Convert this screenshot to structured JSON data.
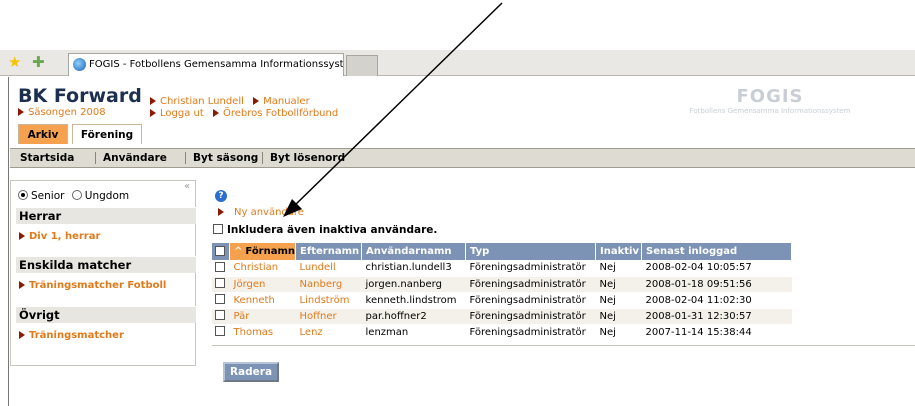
{
  "browser": {
    "tab_title": "FOGIS - Fotbollens Gemensamma Informationssystem"
  },
  "header": {
    "org_name": "BK Forward",
    "season": "Säsongen 2008",
    "links_row1": [
      "Christian Lundell",
      "Manualer"
    ],
    "links_row2": [
      "Logga ut",
      "Örebros Fotbollförbund"
    ],
    "brand_title": "FOGIS",
    "brand_subtitle": "Fotbollens Gemensamma Informationssystem"
  },
  "main_tabs": [
    "Arkiv",
    "Förening"
  ],
  "subnav": [
    "Startsida",
    "Användare",
    "Byt säsong",
    "Byt lösenord"
  ],
  "sidebar": {
    "collapse": "«",
    "radio_options": [
      {
        "label": "Senior",
        "checked": true
      },
      {
        "label": "Ungdom",
        "checked": false
      }
    ],
    "sections": [
      {
        "title": "Herrar",
        "links": [
          "Div 1, herrar"
        ]
      },
      {
        "title": "Enskilda matcher",
        "links": [
          "Träningsmatcher Fotboll"
        ]
      },
      {
        "title": "Övrigt",
        "links": [
          "Träningsmatcher"
        ]
      }
    ]
  },
  "main": {
    "help_icon": "?",
    "new_user_link": "Ny användare",
    "include_inactive_label": "Inkludera även inaktiva användare.",
    "table": {
      "sort_indicator": "^",
      "columns": [
        "Förnamn",
        "Efternamn",
        "Användarnamn",
        "Typ",
        "Inaktiv",
        "Senast inloggad"
      ],
      "rows": [
        [
          "Christian",
          "Lundell",
          "christian.lundell3",
          "Föreningsadministratör",
          "Nej",
          "2008-02-04 10:05:57"
        ],
        [
          "Jörgen",
          "Nanberg",
          "jorgen.nanberg",
          "Föreningsadministratör",
          "Nej",
          "2008-01-18 09:51:56"
        ],
        [
          "Kenneth",
          "Lindström",
          "kenneth.lindstrom",
          "Föreningsadministratör",
          "Nej",
          "2008-02-04 11:02:30"
        ],
        [
          "Pär",
          "Hoffner",
          "par.hoffner2",
          "Föreningsadministratör",
          "Nej",
          "2008-01-31 12:30:57"
        ],
        [
          "Thomas",
          "Lenz",
          "lenzman",
          "Föreningsadministratör",
          "Nej",
          "2007-11-14 15:38:44"
        ]
      ]
    },
    "delete_button": "Radera"
  }
}
